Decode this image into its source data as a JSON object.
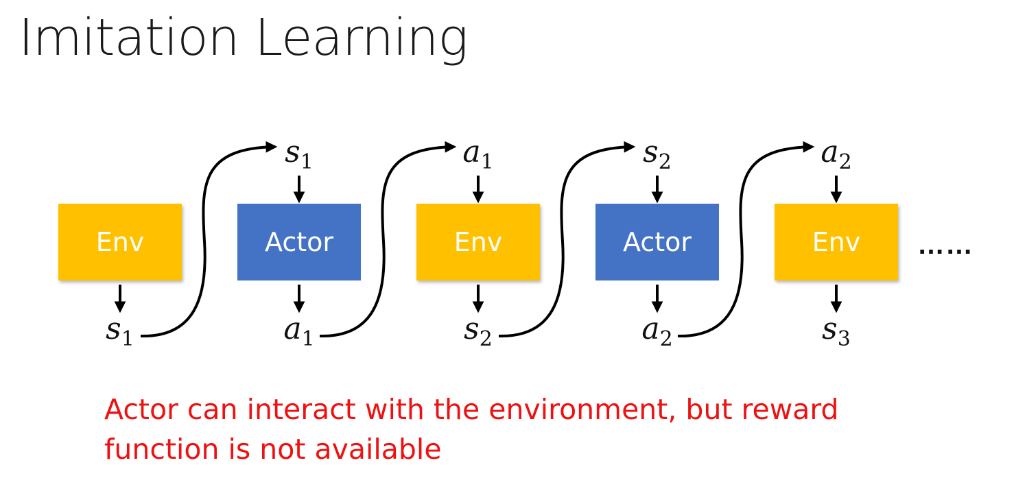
{
  "title": "Imitation Learning",
  "colors": {
    "env_box": "#FFC000",
    "actor_box": "#4472C4",
    "note_text": "#EE1111"
  },
  "nodes": [
    {
      "label": "Env",
      "type": "env",
      "input": null,
      "output": {
        "var": "s",
        "sub": "1"
      }
    },
    {
      "label": "Actor",
      "type": "actor",
      "input": {
        "var": "s",
        "sub": "1"
      },
      "output": {
        "var": "a",
        "sub": "1"
      }
    },
    {
      "label": "Env",
      "type": "env",
      "input": {
        "var": "a",
        "sub": "1"
      },
      "output": {
        "var": "s",
        "sub": "2"
      }
    },
    {
      "label": "Actor",
      "type": "actor",
      "input": {
        "var": "s",
        "sub": "2"
      },
      "output": {
        "var": "a",
        "sub": "2"
      }
    },
    {
      "label": "Env",
      "type": "env",
      "input": {
        "var": "a",
        "sub": "2"
      },
      "output": {
        "var": "s",
        "sub": "3"
      }
    }
  ],
  "continuation": "……",
  "note": "Actor can interact with the environment, but reward function is not available"
}
